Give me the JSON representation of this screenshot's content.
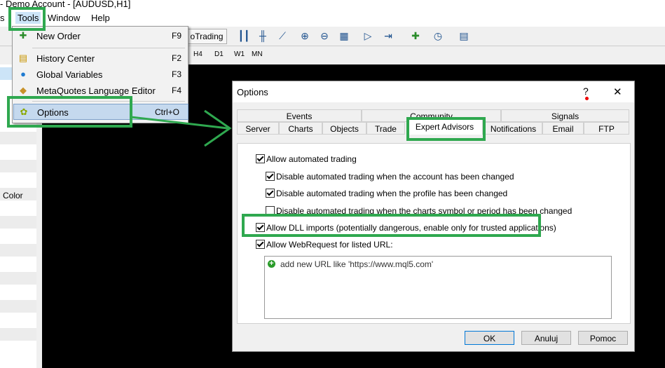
{
  "window": {
    "title": "- Demo Account - [AUDUSD,H1]"
  },
  "menu": {
    "partial": "s",
    "tools": "Tools",
    "window": "Window",
    "help": "Help"
  },
  "toolbar": {
    "autotrading": "oTrading"
  },
  "timeframes": [
    "H4",
    "D1",
    "W1",
    "MN"
  ],
  "left_panel": {
    "color_label": "Color"
  },
  "tools_menu": {
    "items": [
      {
        "label": "New Order",
        "shortcut": "F9",
        "icon": "new-order-icon"
      },
      {
        "label": "History Center",
        "shortcut": "F2",
        "icon": "history-icon"
      },
      {
        "label": "Global Variables",
        "shortcut": "F3",
        "icon": "globe-icon"
      },
      {
        "label": "MetaQuotes Language Editor",
        "shortcut": "F4",
        "icon": "editor-icon"
      },
      {
        "label": "Options",
        "shortcut": "Ctrl+O",
        "icon": "options-icon"
      }
    ]
  },
  "dialog": {
    "title": "Options",
    "help": "?",
    "close": "✕",
    "tabs_row1": [
      "Events",
      "Community",
      "Signals"
    ],
    "tabs_row2": [
      "Server",
      "Charts",
      "Objects",
      "Trade",
      "Expert Advisors",
      "Notifications",
      "Email",
      "FTP"
    ],
    "active_tab": "Expert Advisors",
    "options": [
      {
        "label": "Allow automated trading",
        "checked": true
      },
      {
        "label": "Disable automated trading when the account has been changed",
        "checked": true
      },
      {
        "label": "Disable automated trading when the profile has been changed",
        "checked": true
      },
      {
        "label": "Disable automated trading when the charts symbol or period has been changed",
        "checked": false
      },
      {
        "label": "Allow DLL imports (potentially dangerous, enable only for trusted applications)",
        "checked": true
      },
      {
        "label": "Allow WebRequest for listed URL:",
        "checked": true
      }
    ],
    "url_placeholder": "add new URL like 'https://www.mql5.com'",
    "buttons": {
      "ok": "OK",
      "cancel": "Anuluj",
      "help": "Pomoc"
    }
  },
  "colors": {
    "highlight": "#2fa84f",
    "arrow": "#2fa84f"
  }
}
